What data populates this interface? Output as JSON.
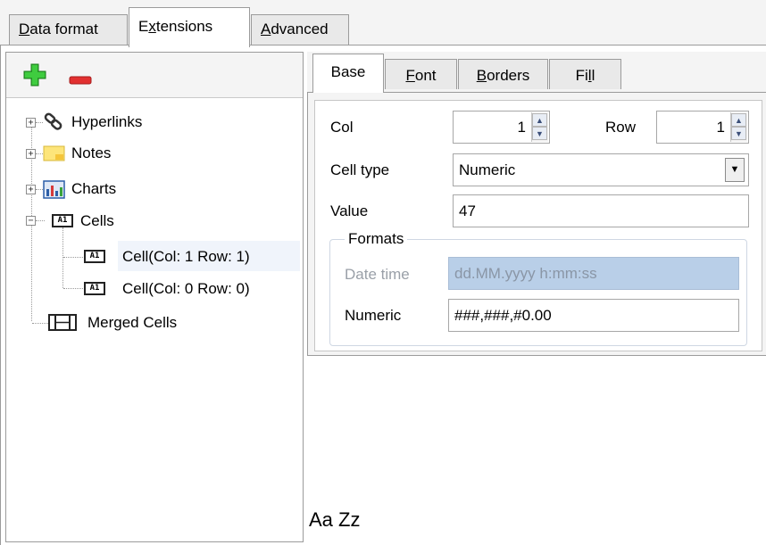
{
  "top_tabs": [
    {
      "label": "Data format",
      "active": false
    },
    {
      "label": "Extensions",
      "active": true
    },
    {
      "label": "Advanced",
      "active": false
    }
  ],
  "toolbar": {
    "add_icon": "plus-icon",
    "remove_icon": "minus-icon"
  },
  "tree": {
    "hyperlinks": {
      "label": "Hyperlinks",
      "expander": "+"
    },
    "notes": {
      "label": "Notes",
      "expander": "+"
    },
    "charts": {
      "label": "Charts",
      "expander": "+"
    },
    "cells": {
      "label": "Cells",
      "expander": "−",
      "children": [
        {
          "label": "Cell(Col: 1 Row: 1)",
          "selected": true
        },
        {
          "label": "Cell(Col: 0 Row: 0)",
          "selected": false
        }
      ]
    },
    "merged": {
      "label": "Merged Cells"
    },
    "cell_icon_text": "A1"
  },
  "sub_tabs": [
    {
      "label": "Base",
      "active": true
    },
    {
      "label": "Font",
      "active": false
    },
    {
      "label": "Borders",
      "active": false
    },
    {
      "label": "Fill",
      "active": false
    }
  ],
  "form": {
    "col_label": "Col",
    "col_value": "1",
    "row_label": "Row",
    "row_value": "1",
    "cell_type_label": "Cell type",
    "cell_type_value": "Numeric",
    "value_label": "Value",
    "value_value": "47",
    "formats_title": "Formats",
    "date_time_label": "Date time",
    "date_time_value": "dd.MM.yyyy h:mm:ss",
    "numeric_label": "Numeric",
    "numeric_value": "###,###,#0.00"
  },
  "preview_text": "Aa Zz",
  "colors": {
    "accent_green": "#2fb32f",
    "accent_red": "#e23030",
    "disabled_field": "#b9cfe8",
    "selection": "#f0f4fb"
  }
}
